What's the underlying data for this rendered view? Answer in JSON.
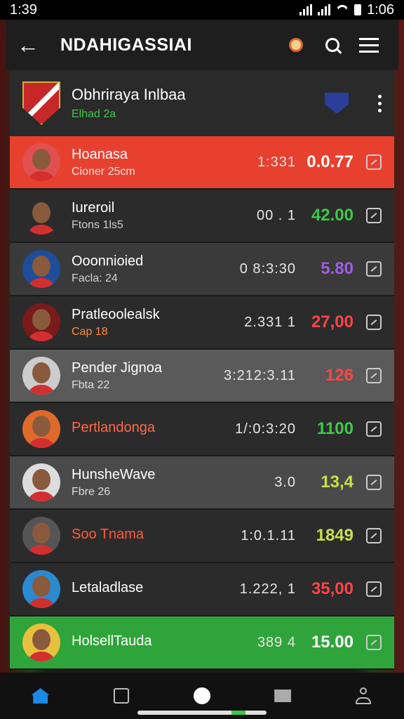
{
  "status": {
    "left_time": "1:39",
    "right_time": "1:06"
  },
  "appbar": {
    "title": "NDAHIGASSIAI"
  },
  "team": {
    "name": "Obhriraya Inlbaa",
    "subtitle": "Elhad 2a"
  },
  "rows": [
    {
      "name": "Hoanasa",
      "sub": "Cioner 25cm",
      "v1": "1:331",
      "v2": "0.0.77",
      "bg": "#e8402f",
      "v2color": "#ffffff",
      "subcolor": "#ffe3dc",
      "avatar_bg": "#e05050"
    },
    {
      "name": "Iureroil",
      "sub": "Ftons 1ls5",
      "v1": "00 . 1",
      "v2": "42.00",
      "bg": "#2b2b2b",
      "v2color": "#3ec84a",
      "subcolor": "#cfcfcf",
      "avatar_bg": "#2b2b2b"
    },
    {
      "name": "Ooonnioied",
      "sub": "Facla: 24",
      "v1": "0 8:3:30",
      "v2": "5.80",
      "bg": "#3a3a3a",
      "v2color": "#a05ee0",
      "subcolor": "#cfcfcf",
      "avatar_bg": "#1e4d9a"
    },
    {
      "name": "Pratleoolealsk",
      "sub": "Cap 18",
      "v1": "2.331  1",
      "v2": "27,00",
      "bg": "#2b2b2b",
      "v2color": "#ff4545",
      "subcolor": "#ff8a3d",
      "avatar_bg": "#7a1a1a"
    },
    {
      "name": "Pender Jignoa",
      "sub": "Fbta 22",
      "v1": "3:212:3.11",
      "v2": "126",
      "bg": "#5a5a5a",
      "v2color": "#ff4545",
      "subcolor": "#dddddd",
      "avatar_bg": "#cccccc"
    },
    {
      "name": "Pertlandonga",
      "sub": "",
      "v1": "1/:0:3:20",
      "v2": "1100",
      "bg": "#2b2b2b",
      "v2color": "#3ec84a",
      "subcolor": "#cfcfcf",
      "avatar_bg": "#e06a2a",
      "namecolor": "#ff6a4a"
    },
    {
      "name": "HunsheWave",
      "sub": "Fbre 26",
      "v1": "3.0",
      "v2": "13,4",
      "bg": "#4a4a4a",
      "v2color": "#c8e04a",
      "subcolor": "#dddddd",
      "avatar_bg": "#dddddd"
    },
    {
      "name": "Soo Tnama",
      "sub": "",
      "v1": "1:0.1.11",
      "v2": "1849",
      "bg": "#2b2b2b",
      "v2color": "#c8e04a",
      "subcolor": "#cfcfcf",
      "avatar_bg": "#555555",
      "namecolor": "#ff5a3a"
    },
    {
      "name": "Letaladlase",
      "sub": "",
      "v1": "1.222, 1",
      "v2": "35,00",
      "bg": "#2b2b2b",
      "v2color": "#ff4545",
      "subcolor": "#cfcfcf",
      "avatar_bg": "#2a8ad0"
    },
    {
      "name": "HolsellTauda",
      "sub": "",
      "v1": "389 4",
      "v2": "15.00",
      "bg": "#2fa43a",
      "v2color": "#ffffff",
      "subcolor": "#cfcfcf",
      "avatar_bg": "#e8c040"
    }
  ],
  "nav": {
    "home": "home-icon",
    "list": "list-icon",
    "center": "circle-icon",
    "inbox": "inbox-icon",
    "profile": "profile-icon"
  }
}
